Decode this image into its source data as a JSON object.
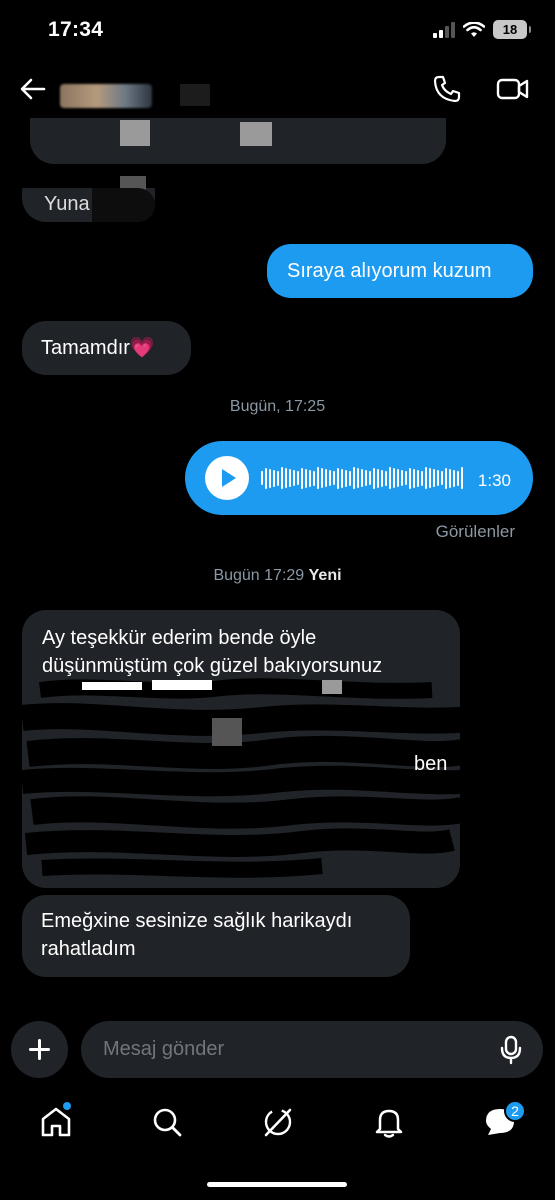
{
  "status_bar": {
    "time": "17:34",
    "battery": "18"
  },
  "icons": {
    "back": "arrow-left-icon",
    "call": "phone-icon",
    "video": "video-camera-icon",
    "signal": "cellular-signal-icon",
    "wifi": "wifi-icon",
    "battery": "battery-icon",
    "add": "plus-icon",
    "mic": "microphone-icon",
    "nav": [
      "home-icon",
      "search-icon",
      "grok-icon",
      "bell-icon",
      "messages-icon"
    ]
  },
  "colors": {
    "accent": "#1d9bf0",
    "incoming_bubble": "#202327",
    "background": "#000000",
    "muted_text": "#8b98a5"
  },
  "messages": {
    "partial_top": "Yuna",
    "outgoing_1": "Sıraya alıyorum kuzum",
    "incoming_1": "Tamamdır💗",
    "separator_1": "Bugün, 17:25",
    "voice_duration": "1:30",
    "seen_label": "Görülenler",
    "separator_2_time": "Bugün 17:29",
    "separator_2_new": "Yeni",
    "incoming_long_line1": "Ay teşekkür ederim bende öyle",
    "incoming_long_line2": "düşünmüştüm çok güzel bakıyorsunuz",
    "incoming_last": "Emeğxine sesinize sağlık harikaydı rahatladım"
  },
  "composer": {
    "placeholder": "Mesaj gönder"
  },
  "nav": {
    "messages_badge": "2"
  }
}
